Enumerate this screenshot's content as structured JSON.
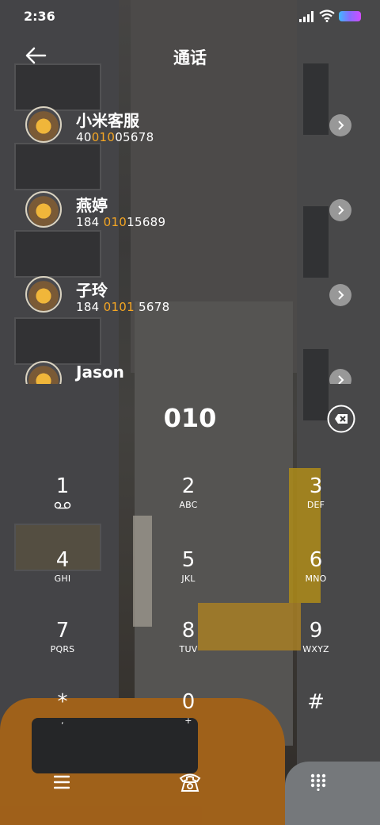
{
  "status_bar": {
    "time": "2:36"
  },
  "header": {
    "title": "通话"
  },
  "contacts": [
    {
      "name": "小米客服",
      "number_pre": "40",
      "number_hl": "010",
      "number_post": "05678"
    },
    {
      "name": "燕婷",
      "number_pre": "184 ",
      "number_hl": "010",
      "number_post": "15689"
    },
    {
      "name": "子玲",
      "number_pre": "184 ",
      "number_hl": "0101",
      "number_post": " 5678"
    },
    {
      "name": "Jason",
      "number_pre": "",
      "number_hl": "",
      "number_post": ""
    }
  ],
  "dialer": {
    "input": "010"
  },
  "keypad": [
    {
      "digit": "1",
      "letters": ""
    },
    {
      "digit": "2",
      "letters": "ABC"
    },
    {
      "digit": "3",
      "letters": "DEF"
    },
    {
      "digit": "4",
      "letters": "GHI"
    },
    {
      "digit": "5",
      "letters": "JKL"
    },
    {
      "digit": "6",
      "letters": "MNO"
    },
    {
      "digit": "7",
      "letters": "PQRS"
    },
    {
      "digit": "8",
      "letters": "TUV"
    },
    {
      "digit": "9",
      "letters": "WXYZ"
    },
    {
      "digit": "*",
      "letters": ","
    },
    {
      "digit": "0",
      "letters": "+"
    },
    {
      "digit": "#",
      "letters": ""
    }
  ],
  "icons": {
    "back": "back-arrow-icon",
    "delete": "backspace-icon",
    "menu": "menu-icon",
    "call": "phone-icon",
    "keypad": "dialpad-icon",
    "voicemail": "voicemail-icon"
  },
  "colors": {
    "highlight": "#f5a623",
    "battery_gradient": [
      "#3fb8ff",
      "#d04dff"
    ]
  }
}
